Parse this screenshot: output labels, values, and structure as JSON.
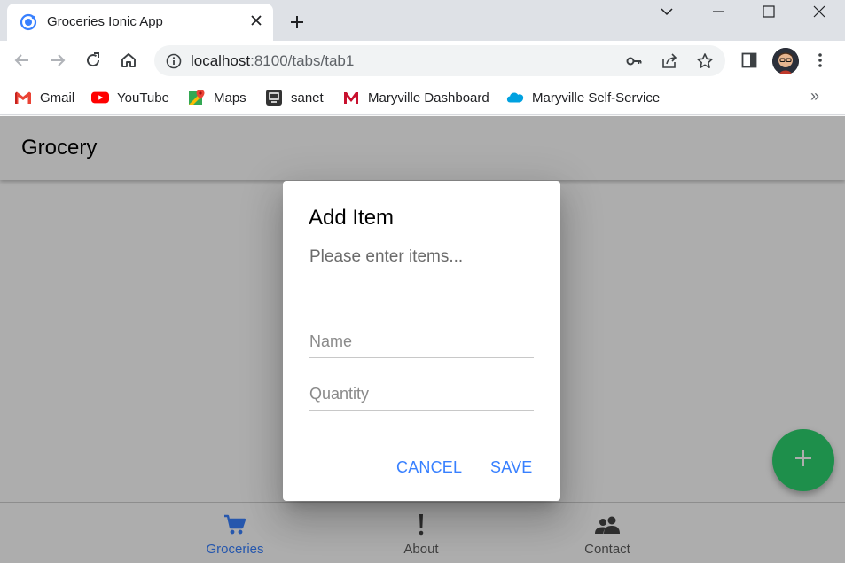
{
  "browser": {
    "tab_title": "Groceries Ionic App",
    "url_host": "localhost",
    "url_path": ":8100/tabs/tab1",
    "bookmarks": [
      {
        "label": "Gmail",
        "icon": "gmail-icon"
      },
      {
        "label": "YouTube",
        "icon": "youtube-icon"
      },
      {
        "label": "Maps",
        "icon": "maps-icon"
      },
      {
        "label": "sanet",
        "icon": "sanet-icon"
      },
      {
        "label": "Maryville Dashboard",
        "icon": "maryville-icon"
      },
      {
        "label": "Maryville Self-Service",
        "icon": "salesforce-cloud-icon"
      }
    ],
    "bookmarks_more": "»"
  },
  "app": {
    "header_title": "Grocery",
    "tabs": [
      {
        "label": "Groceries",
        "icon": "cart-icon",
        "selected": true
      },
      {
        "label": "About",
        "icon": "exclamation-icon",
        "selected": false
      },
      {
        "label": "Contact",
        "icon": "people-icon",
        "selected": false
      }
    ],
    "fab_icon": "plus-icon",
    "colors": {
      "primary": "#3880ff",
      "selected_tab": "#3880ff",
      "fab": "#2dd36f"
    }
  },
  "dialog": {
    "title": "Add Item",
    "message": "Please enter items...",
    "name_placeholder": "Name",
    "name_value": "",
    "quantity_placeholder": "Quantity",
    "quantity_value": "",
    "cancel_label": "CANCEL",
    "save_label": "SAVE"
  }
}
